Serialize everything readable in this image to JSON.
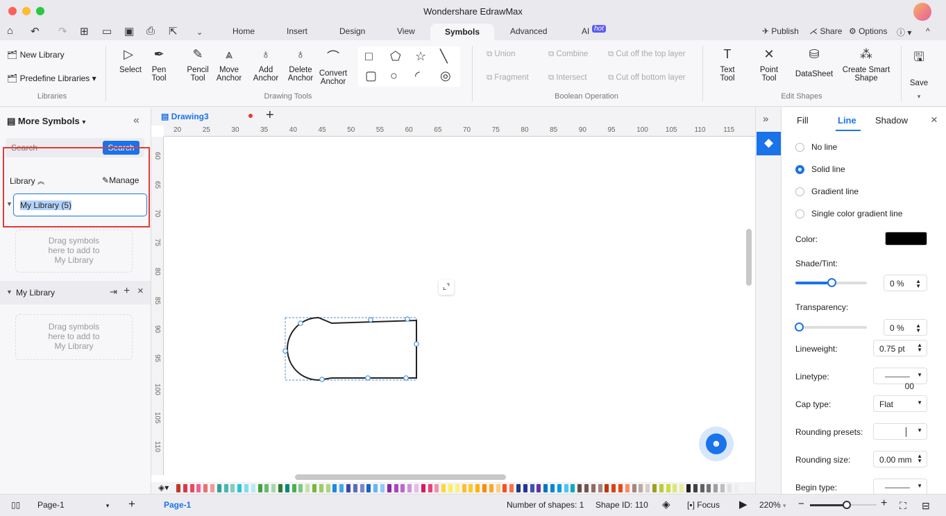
{
  "app": {
    "title": "Wondershare EdrawMax"
  },
  "menu_tabs": [
    "Home",
    "Insert",
    "Design",
    "View",
    "Symbols",
    "Advanced",
    "AI"
  ],
  "ai_badge": "hot",
  "top_right": {
    "publish": "Publish",
    "share": "Share",
    "options": "Options"
  },
  "ribbon": {
    "libraries": {
      "new_library": "New Library",
      "predefine": "Predefine Libraries",
      "group": "Libraries"
    },
    "drawing_tools": {
      "items": [
        "Select",
        "Pen\nTool",
        "Pencil\nTool",
        "Move\nAnchor",
        "Add\nAnchor",
        "Delete\nAnchor",
        "Convert\nAnchor"
      ],
      "group": "Drawing Tools"
    },
    "boolean": {
      "items": [
        "Union",
        "Combine",
        "Cut off the top layer",
        "Fragment",
        "Intersect",
        "Cut off bottom layer"
      ],
      "group": "Boolean Operation"
    },
    "edit_shapes": {
      "items": [
        "Text\nTool",
        "Point\nTool",
        "DataSheet",
        "Create Smart\nShape"
      ],
      "group": "Edit Shapes"
    },
    "save": "Save"
  },
  "left_panel": {
    "title": "More Symbols",
    "search_placeholder": "Search",
    "search_button": "Search",
    "library_label": "Library",
    "manage": "Manage",
    "library_name_input": "My Library (5)",
    "drag_hint_1": "Drag symbols\nhere to add to\nMy Library",
    "my_library": "My Library",
    "drag_hint_2": "Drag symbols\nhere to add to\nMy Library"
  },
  "document": {
    "tab": "Drawing3"
  },
  "rulers": {
    "h": [
      20,
      25,
      30,
      35,
      40,
      45,
      50,
      55,
      60,
      65,
      70,
      75,
      80,
      85,
      90,
      95,
      100,
      105,
      110,
      115
    ],
    "v": [
      60,
      65,
      70,
      75,
      80,
      85,
      90,
      95,
      100,
      105,
      110
    ]
  },
  "right_panel": {
    "tabs": [
      "Fill",
      "Line",
      "Shadow"
    ],
    "active_tab": "Line",
    "line_options": [
      "No line",
      "Solid line",
      "Gradient line",
      "Single color gradient line"
    ],
    "selected_option": "Solid line",
    "color_label": "Color:",
    "color_value": "#000000",
    "shade_label": "Shade/Tint:",
    "shade_value": "0 %",
    "shade_slider_fraction": 0.5,
    "transparency_label": "Transparency:",
    "transparency_value": "0 %",
    "transparency_slider_fraction": 0,
    "lineweight_label": "Lineweight:",
    "lineweight_value": "0.75 pt",
    "linetype_label": "Linetype:",
    "linetype_value": "00",
    "cap_label": "Cap type:",
    "cap_value": "Flat",
    "rounding_presets_label": "Rounding presets:",
    "rounding_size_label": "Rounding size:",
    "rounding_size_value": "0.00 mm",
    "begin_type_label": "Begin type:",
    "begin_type_value": "00"
  },
  "bottom": {
    "page_select": "Page-1",
    "page_tab": "Page-1",
    "shapes": "Number of shapes: 1",
    "shape_id": "Shape ID: 110",
    "focus": "Focus",
    "zoom": "220%",
    "zoom_fraction": 0.55
  },
  "accent": "#1a73e8",
  "palette_colors": [
    "#c0392b",
    "#d63a4a",
    "#e84a5f",
    "#f06292",
    "#e57373",
    "#ef9a9a",
    "#26a69a",
    "#4db6ac",
    "#80cbc4",
    "#26c6da",
    "#80deea",
    "#b2ebf2",
    "#43a047",
    "#66bb6a",
    "#a5d6a7",
    "#2e7d32",
    "#00897b",
    "#4caf50",
    "#81c784",
    "#c5e1a5",
    "#7cb342",
    "#9ccc65",
    "#aed581",
    "#1e88e5",
    "#42a5f5",
    "#3949ab",
    "#5c6bc0",
    "#7986cb",
    "#1565c0",
    "#64b5f6",
    "#90caf9",
    "#8e24aa",
    "#ab47bc",
    "#ba68c8",
    "#ce93d8",
    "#e1bee7",
    "#d81b60",
    "#ec407a",
    "#f48fb1",
    "#fdd835",
    "#ffee58",
    "#fff176",
    "#fbc02d",
    "#ffca28",
    "#ffb300",
    "#fb8c00",
    "#ffa726",
    "#ffcc80",
    "#f4511e",
    "#ff7043",
    "#1e3a8a",
    "#283593",
    "#3f51b5",
    "#5e35b1",
    "#0277bd",
    "#0288d1",
    "#039be5",
    "#4fc3f7",
    "#00acc1",
    "#6d4c41",
    "#795548",
    "#8d6e63",
    "#a1887f",
    "#bf360c",
    "#d84315",
    "#e64a19",
    "#ff8a65",
    "#a1887f",
    "#bcaaa4",
    "#d7ccc8",
    "#9e9d24",
    "#c0ca33",
    "#cddc39",
    "#dce775",
    "#e6ee9c",
    "#212121",
    "#424242",
    "#616161",
    "#757575",
    "#9e9e9e",
    "#bdbdbd",
    "#e0e0e0",
    "#eeeeee",
    "#f5f5f5"
  ]
}
